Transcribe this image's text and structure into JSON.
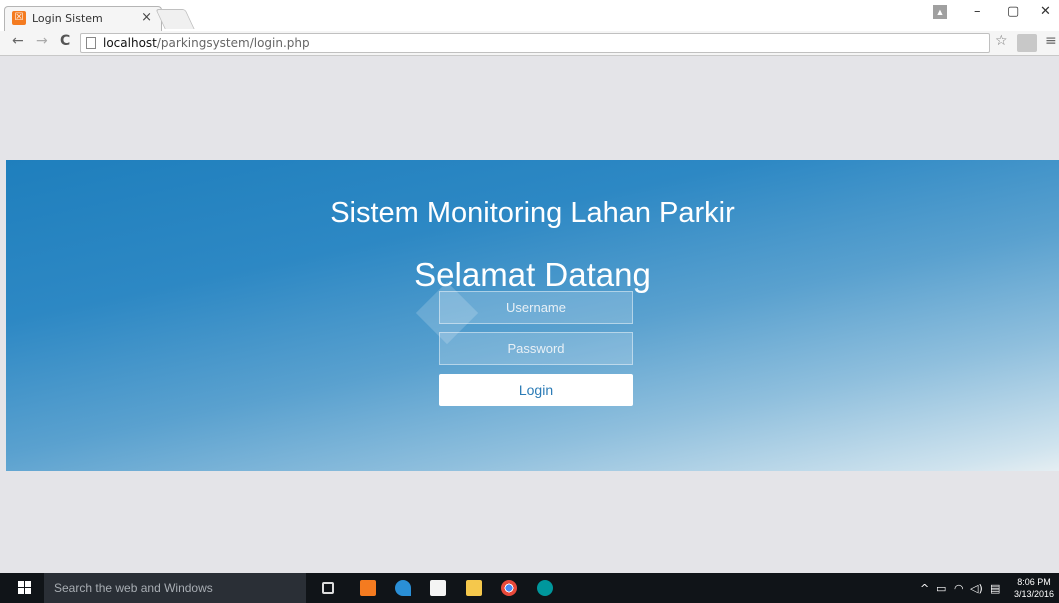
{
  "browser": {
    "tab_title": "Login Sistem",
    "tab_close": "×",
    "url_host": "localhost",
    "url_path": "/parkingsystem/login.php",
    "back": "←",
    "forward": "→",
    "reload": "C",
    "star": "☆",
    "menu": "≡",
    "minimize": "–",
    "restore": "▢",
    "close": "✕"
  },
  "page": {
    "heading": "Sistem Monitoring Lahan Parkir",
    "subheading": "Selamat Datang",
    "username_placeholder": "Username",
    "password_placeholder": "Password",
    "login_label": "Login",
    "colors": {
      "hero_start": "#1f7fbd",
      "hero_end": "#e5eef2",
      "login_text": "#2b7bb6"
    }
  },
  "taskbar": {
    "search_placeholder": "Search the web and Windows",
    "time": "8:06 PM",
    "date": "3/13/2016",
    "icons": [
      "task-view-icon",
      "xampp-icon",
      "app-icon",
      "store-icon",
      "file-explorer-icon",
      "chrome-icon",
      "arduino-icon"
    ]
  }
}
